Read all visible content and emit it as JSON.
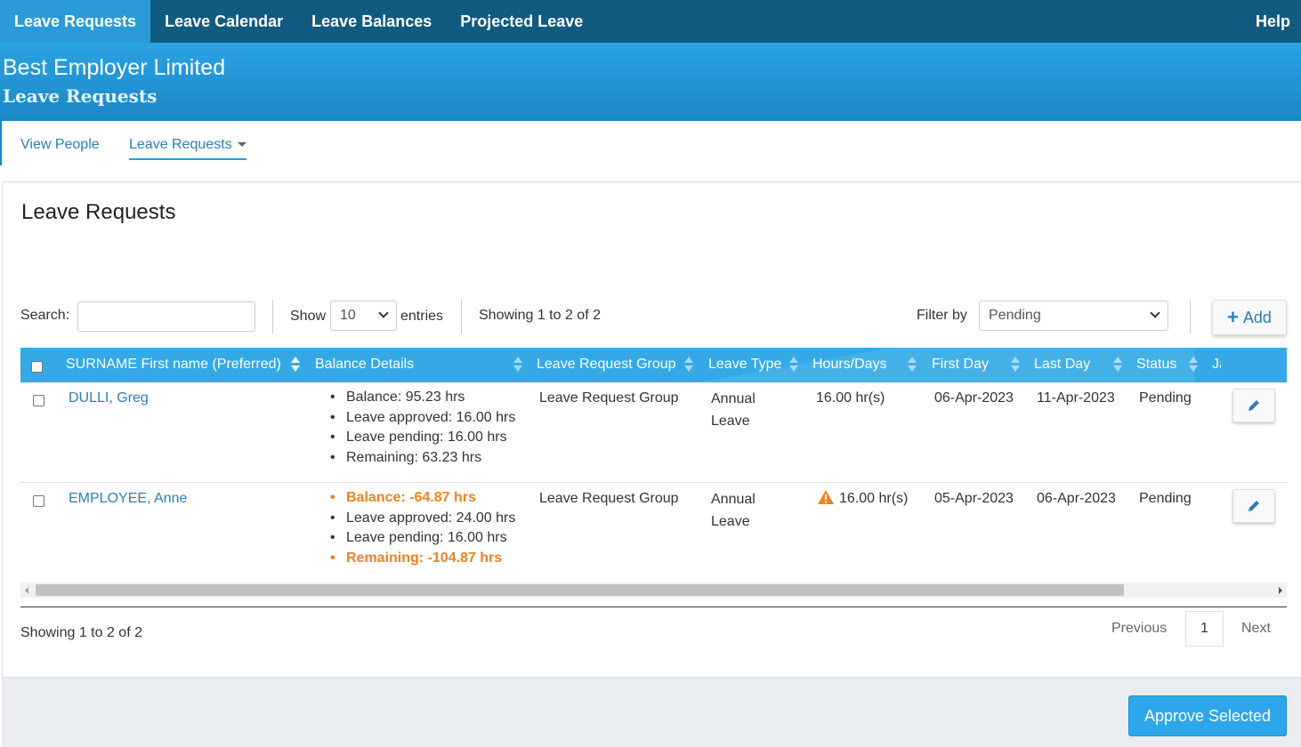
{
  "topnav": {
    "tabs": [
      "Leave Requests",
      "Leave Calendar",
      "Leave Balances",
      "Projected Leave"
    ],
    "help": "Help"
  },
  "banner": {
    "company": "Best Employer Limited",
    "page": "Leave Requests"
  },
  "subnav": {
    "view_people": "View People",
    "leave_requests": "Leave Requests"
  },
  "panel": {
    "title": "Leave Requests",
    "search_label": "Search:",
    "search_value": "",
    "show_label": "Show",
    "show_value": "10",
    "entries_label": "entries",
    "info_top": "Showing 1 to 2 of 2",
    "filter_label": "Filter by",
    "filter_value": "Pending",
    "add_label": "Add"
  },
  "table": {
    "headers": [
      "SURNAME First name (Preferred)",
      "Balance Details",
      "Leave Request Group",
      "Leave Type",
      "Hours/Days",
      "First Day",
      "Last Day",
      "Status",
      "Ja"
    ],
    "rows": [
      {
        "name": "DULLI, Greg",
        "balance": [
          "Balance: 95.23 hrs",
          "Leave approved: 16.00 hrs",
          "Leave pending: 16.00 hrs",
          "Remaining: 63.23 hrs"
        ],
        "group": "Leave Request Group",
        "type": "Annual Leave",
        "hours": "16.00 hr(s)",
        "first_day": "06-Apr-2023",
        "last_day": "11-Apr-2023",
        "status": "Pending"
      },
      {
        "name": "EMPLOYEE, Anne",
        "balance": [
          "Balance: -64.87 hrs",
          "Leave approved: 24.00 hrs",
          "Leave pending: 16.00 hrs",
          "Remaining: -104.87 hrs"
        ],
        "group": "Leave Request Group",
        "type": "Annual Leave",
        "hours": "16.00 hr(s)",
        "first_day": "05-Apr-2023",
        "last_day": "06-Apr-2023",
        "status": "Pending"
      }
    ]
  },
  "footer": {
    "info_bottom": "Showing 1 to 2 of 2",
    "previous": "Previous",
    "page": "1",
    "next": "Next",
    "approve": "Approve Selected"
  },
  "colors": {
    "nav": "#115a80",
    "accent": "#2a9bd8",
    "warning": "#f0821f",
    "link": "#2a7fb5"
  }
}
